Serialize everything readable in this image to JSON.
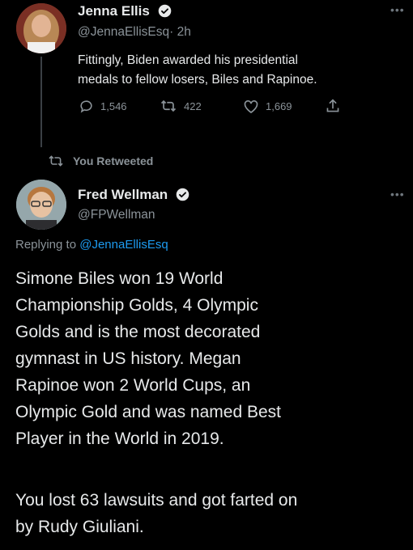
{
  "tweet1": {
    "name": "Jenna Ellis",
    "handle": "@JennaEllisEsq",
    "time": "· 2h",
    "text_line1": "Fittingly, Biden awarded his presidential",
    "text_line2": "medals to fellow losers, Biles and Rapinoe.",
    "replies": "1,546",
    "retweets": "422",
    "likes": "1,669"
  },
  "retweet_banner": "You Retweeted",
  "tweet2": {
    "name": "Fred Wellman",
    "handle": "@FPWellman",
    "replying_prefix": "Replying to ",
    "replying_handle": "@JennaEllisEsq",
    "para1_lines": [
      "Simone Biles won 19 World",
      "Championship Golds, 4 Olympic",
      "Golds and is the most decorated",
      "gymnast in US history. Megan",
      "Rapinoe won 2 World Cups, an",
      "Olympic Gold and was named Best",
      "Player in the World in 2019."
    ],
    "para2_lines": [
      "You lost 63 lawsuits and got farted on",
      "by Rudy Giuliani."
    ]
  },
  "icons": {
    "verified": "verified-badge-icon",
    "reply": "reply-icon",
    "retweet": "retweet-icon",
    "like": "heart-icon",
    "share": "share-icon",
    "more": "more-icon"
  },
  "colors": {
    "background": "#000000",
    "text": "#e7e9ea",
    "secondary": "#8b9399",
    "accent": "#1d9bf0"
  }
}
